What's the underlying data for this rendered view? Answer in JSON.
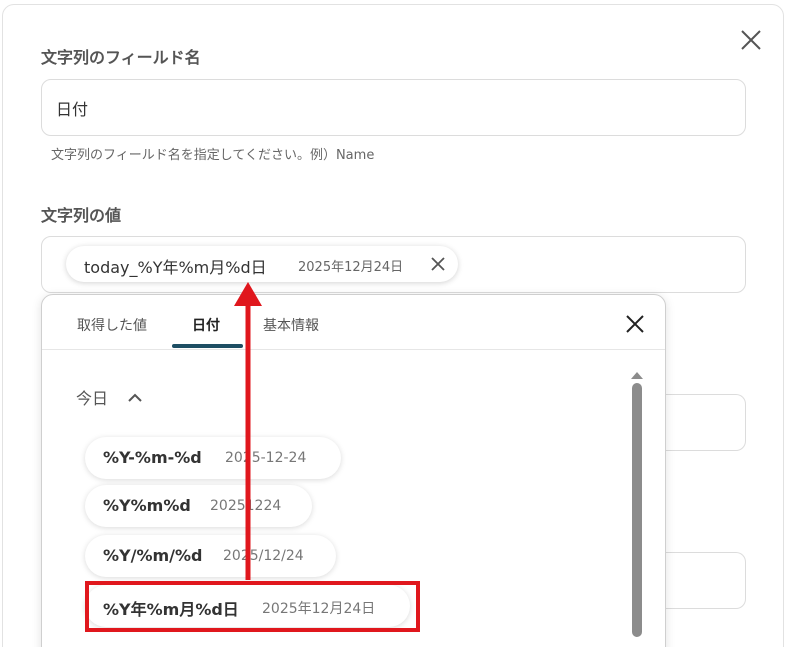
{
  "form": {
    "field_name_label": "文字列のフィールド名",
    "field_name_value": "日付",
    "field_name_hint": "文字列のフィールド名を指定してください。例）Name",
    "value_label": "文字列の値",
    "value_chip": {
      "label": "today_%Y年%m月%d日",
      "preview": "2025年12月24日"
    }
  },
  "dropdown": {
    "tabs": [
      {
        "label": "取得した値",
        "active": false
      },
      {
        "label": "日付",
        "active": true
      },
      {
        "label": "基本情報",
        "active": false
      }
    ],
    "section": {
      "title": "今日",
      "expanded": true
    },
    "options": [
      {
        "label": "%Y-%m-%d",
        "preview": "2025-12-24"
      },
      {
        "label": "%Y%m%d",
        "preview": "20251224"
      },
      {
        "label": "%Y/%m/%d",
        "preview": "2025/12/24"
      },
      {
        "label": "%Y年%m月%d日",
        "preview": "2025年12月24日",
        "highlighted": true
      }
    ]
  },
  "colors": {
    "accent": "#1d4e63",
    "highlight": "#e0171d",
    "scrollbar": "#8c8c8c"
  },
  "icons": {
    "main_close": "close-icon",
    "chip_remove": "close-icon",
    "dropdown_close": "close-icon",
    "section_toggle": "chevron-up-icon",
    "scroll_up": "triangle-up-icon"
  }
}
